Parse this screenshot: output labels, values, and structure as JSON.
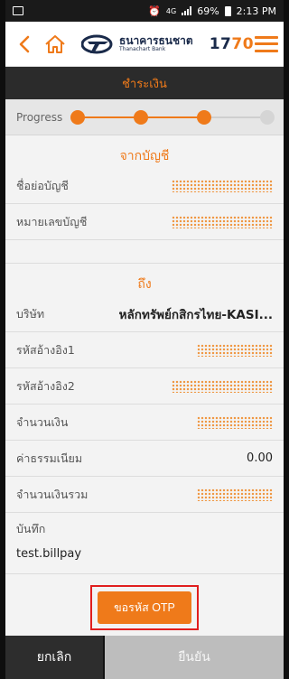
{
  "status_bar": {
    "network": "4G",
    "battery": "69%",
    "time": "2:13 PM"
  },
  "header": {
    "logo_text": "ธนาคารธนชาต",
    "logo_subtext": "Thanachart Bank",
    "hotline_prefix": "17",
    "hotline_suffix": "70",
    "icons": [
      "back-icon",
      "home-icon",
      "menu-icon"
    ]
  },
  "page_title": "ชำระเงิน",
  "progress": {
    "label": "Progress",
    "completed_steps": 3,
    "total_steps": 4
  },
  "from_section": {
    "title": "จากบัญชี",
    "rows": [
      {
        "label": "ชื่อย่อบัญชี"
      },
      {
        "label": "หมายเลขบัญชี"
      }
    ]
  },
  "to_section": {
    "title": "ถึง",
    "company_label": "บริษัท",
    "company_value": "หลักทรัพย์กสิกรไทย-KASI...",
    "ref1_label": "รหัสอ้างอิง1",
    "ref2_label": "รหัสอ้างอิง2",
    "amount_label": "จำนวนเงิน",
    "fee_label": "ค่าธรรมเนียม",
    "fee_value": "0.00",
    "total_label": "จำนวนเงินรวม",
    "note_label": "บันทึก",
    "note_value": "test.billpay"
  },
  "otp_button": "ขอรหัส OTP",
  "footer": {
    "cancel": "ยกเลิก",
    "confirm": "ยืนยัน"
  },
  "colors": {
    "accent": "#ef7a1a",
    "title_bar": "#2b2b2b",
    "highlight_frame": "#e01e1e"
  }
}
